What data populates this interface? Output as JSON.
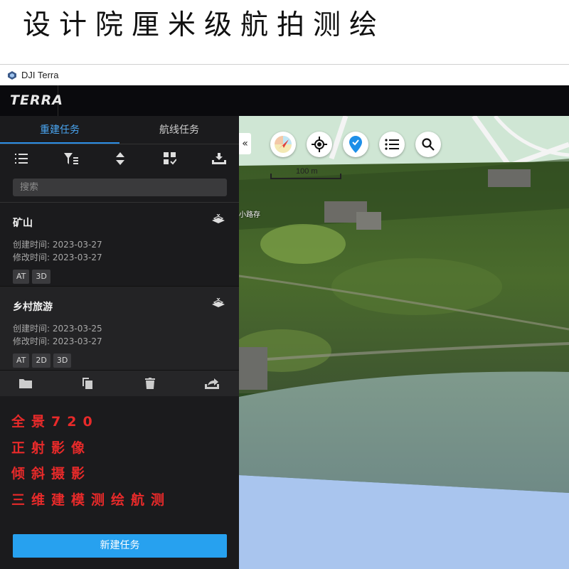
{
  "banner": {
    "title": "设计院厘米级航拍测绘"
  },
  "window": {
    "title": "DJI Terra"
  },
  "header": {
    "brand": "TERRA"
  },
  "sidebar": {
    "tabs": [
      {
        "label": "重建任务",
        "active": true
      },
      {
        "label": "航线任务",
        "active": false
      }
    ],
    "toolbar": [
      "list-icon",
      "filter-icon",
      "sort-icon",
      "select-grid-icon",
      "import-icon"
    ],
    "search": {
      "placeholder": "搜索",
      "value": ""
    },
    "tasks": [
      {
        "name": "矿山",
        "created": "创建时间: 2023-03-27",
        "modified": "修改时间: 2023-03-27",
        "tags": [
          "AT",
          "3D"
        ]
      },
      {
        "name": "乡村旅游",
        "created": "创建时间: 2023-03-25",
        "modified": "修改时间: 2023-03-27",
        "tags": [
          "AT",
          "2D",
          "3D"
        ]
      }
    ],
    "actions": [
      "folder-icon",
      "copy-icon",
      "trash-icon",
      "export-icon"
    ],
    "promo": [
      "全景720",
      "正射影像",
      "倾斜摄影",
      "三维建模测绘航测"
    ],
    "new_task_label": "新建任务"
  },
  "map": {
    "collapse_label": "«",
    "scale_label": "100 m",
    "place_label": "小路存",
    "controls": [
      "compass-icon",
      "locate-icon",
      "pin-icon",
      "layers-list-icon",
      "search-icon"
    ]
  },
  "colors": {
    "accent": "#27a1ef",
    "tab_active": "#4aa6f2",
    "promo_red": "#e82a2a",
    "sidebar_bg": "#1b1b1d",
    "header_bg": "#0a0a0d"
  }
}
